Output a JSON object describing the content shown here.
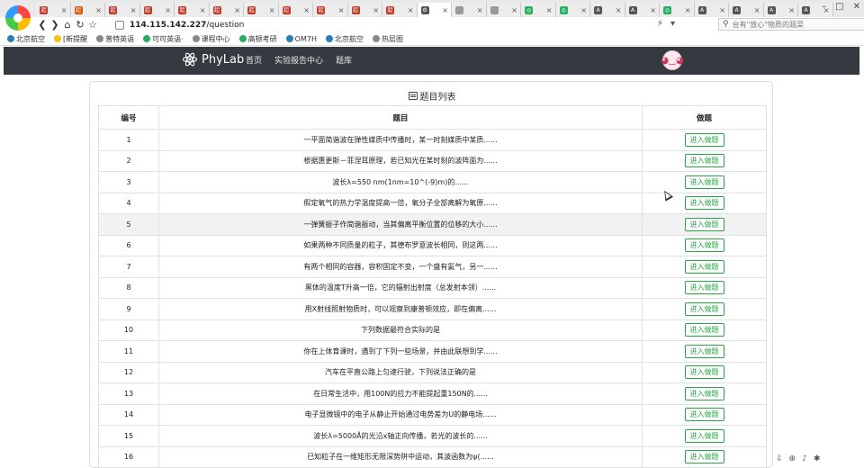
{
  "browser": {
    "tabs": [
      {
        "label": "起",
        "color": "#c0392b"
      },
      {
        "label": "起",
        "color": "#d35400"
      },
      {
        "label": "起",
        "color": "#c0392b"
      },
      {
        "label": "起",
        "color": "#c0392b"
      },
      {
        "label": "起",
        "color": "#c0392b"
      },
      {
        "label": "起",
        "color": "#c0392b"
      },
      {
        "label": "起",
        "color": "#c0392b"
      },
      {
        "label": "起",
        "color": "#c0392b"
      },
      {
        "label": "起",
        "color": "#c0392b"
      },
      {
        "label": "起",
        "color": "#c0392b"
      },
      {
        "label": "起",
        "color": "#c0392b"
      },
      {
        "label": "⚙",
        "color": "#555"
      },
      {
        "label": "",
        "color": "#999"
      },
      {
        "label": "",
        "color": "#999"
      },
      {
        "label": "◎",
        "color": "#27ae60"
      },
      {
        "label": "◎",
        "color": "#27ae60"
      },
      {
        "label": "A",
        "color": "#555"
      },
      {
        "label": "A",
        "color": "#555"
      },
      {
        "label": "◎",
        "color": "#27ae60"
      },
      {
        "label": "A",
        "color": "#555"
      },
      {
        "label": "A",
        "color": "#555"
      },
      {
        "label": "A",
        "color": "#555"
      },
      {
        "label": "A",
        "color": "#555"
      }
    ],
    "address_host": "114.115.142.227",
    "address_path": "/question",
    "search_placeholder": "台有\"放心\"物质的蔬菜",
    "bookmarks": [
      {
        "label": "北京航空",
        "color": "#2980b9"
      },
      {
        "label": "[新提醒",
        "color": "#f1c40f"
      },
      {
        "label": "普特英语",
        "color": "#888"
      },
      {
        "label": "可可英语·",
        "color": "#27ae60"
      },
      {
        "label": "课程中心",
        "color": "#888"
      },
      {
        "label": "高顿考研",
        "color": "#27ae60"
      },
      {
        "label": "OM7H",
        "color": "#2980b9"
      },
      {
        "label": "北京航空",
        "color": "#2980b9"
      },
      {
        "label": "热层图",
        "color": "#888"
      }
    ]
  },
  "site": {
    "brand": "PhyLab",
    "nav": [
      "首页",
      "实验报告中心",
      "题库"
    ]
  },
  "card": {
    "title": "题目列表",
    "columns": [
      "编号",
      "题目",
      "做题"
    ],
    "button_label": "进入做题",
    "rows": [
      {
        "id": "1",
        "text": "一平面简谐波在弹性媒质中传播时，某一时刻媒质中某质......"
      },
      {
        "id": "2",
        "text": "根据惠更斯－菲涅耳原理，若已知光在某时刻的波阵面为......"
      },
      {
        "id": "3",
        "text": "波长λ=550 nm(1nm=10^(-9)m)的......"
      },
      {
        "id": "4",
        "text": "假定氧气的热力学温度提高一倍，氧分子全部离解为氧原......"
      },
      {
        "id": "5",
        "text": "一弹簧振子作简谐振动，当其偏离平衡位置的位移的大小......"
      },
      {
        "id": "6",
        "text": "如果两种不同质量的粒子，其德布罗意波长相同，则这两......"
      },
      {
        "id": "7",
        "text": "有两个相同的容器，容积固定不变，一个盛有氦气，另一......"
      },
      {
        "id": "8",
        "text": "黑体的温度T升高一倍，它的辐射出射度（总发射本领）......"
      },
      {
        "id": "9",
        "text": "用X射线照射物质时，可以观察到康普顿效应，即在偏离......"
      },
      {
        "id": "10",
        "text": "下列数据最符合实际的是"
      },
      {
        "id": "11",
        "text": "你在上体育课时，遇到了下列一些场景，并由此联想到学......"
      },
      {
        "id": "12",
        "text": "汽车在平直公路上匀速行驶，下列说法正确的是"
      },
      {
        "id": "13",
        "text": "在日常生活中，用100N的拉力不能提起重150N的......"
      },
      {
        "id": "14",
        "text": "电子显微镜中的电子从静止开始通过电势差为U的静电场......"
      },
      {
        "id": "15",
        "text": "波长λ=5000Å的光沿x轴正向传播，若光的波长的......"
      },
      {
        "id": "16",
        "text": "已知粒子在一维矩形无限深势阱中运动，其波函数为ψ(......"
      }
    ]
  }
}
